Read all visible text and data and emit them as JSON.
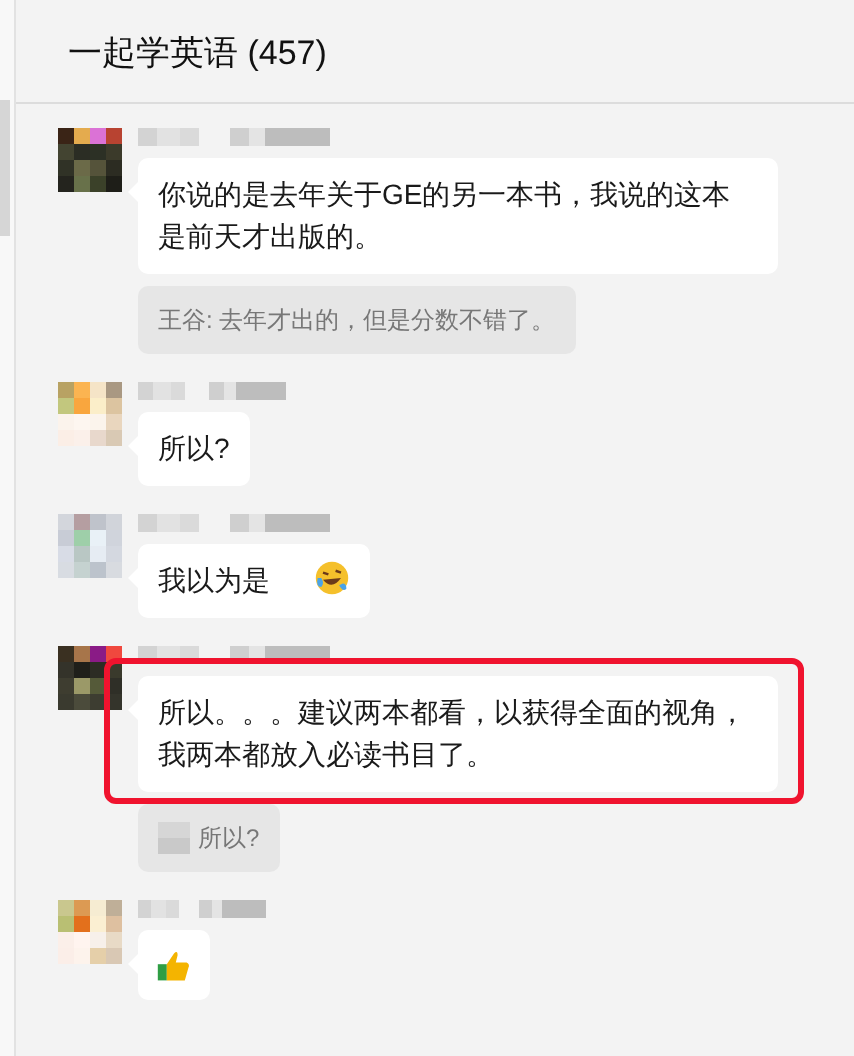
{
  "window": {
    "title": "一起学英语 (457)"
  },
  "messages": [
    {
      "kind": "text",
      "text": "你说的是去年关于GE的另一本书，我说的这本是前天才出版的。",
      "highlighted": false,
      "quote": {
        "text": "王谷: 去年才出的，但是分数不错了。"
      }
    },
    {
      "kind": "text",
      "text": "所以?",
      "highlighted": false
    },
    {
      "kind": "text-emoji",
      "text": "我以为是",
      "highlighted": false
    },
    {
      "kind": "text",
      "text": "所以。。。建议两本都看，以获得全面的视角，我两本都放入必读书目了。",
      "highlighted": true,
      "quote": {
        "text": "所以?",
        "redacted_prefix": true
      }
    },
    {
      "kind": "sticker",
      "highlighted": false
    }
  ]
}
